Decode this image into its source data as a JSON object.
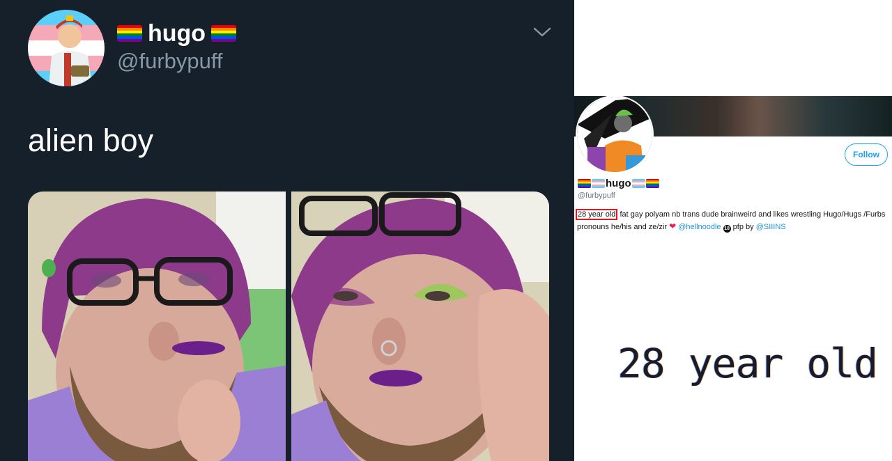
{
  "tweet": {
    "display_name": "hugo",
    "handle": "@furbypuff",
    "text": "alien boy",
    "icons": [
      "rainbow-flag-icon",
      "chevron-down-icon"
    ],
    "colors": {
      "background": "#15202b",
      "text": "#ffffff",
      "secondary": "#8899a6"
    }
  },
  "profile": {
    "display_name": "hugo",
    "handle": "@furbypuff",
    "follow_label": "Follow",
    "bio": {
      "highlight": "28 year old",
      "text": " fat gay polyam nb trans dude brainweird and likes wrestling Hugo/Hugs /Furbs pronouns he/his and ze/zir ",
      "link_partner": "@hellnoodle",
      "mid_text": " pfp by ",
      "link_artist": "@SIIINS"
    },
    "icons": [
      "rainbow-flag-icon",
      "trans-flag-icon",
      "heart-icon",
      "age-18-icon"
    ],
    "colors": {
      "accent": "#1da1f2",
      "highlight_box": "#e0191f"
    }
  },
  "zoom": {
    "text": "28 year old"
  }
}
